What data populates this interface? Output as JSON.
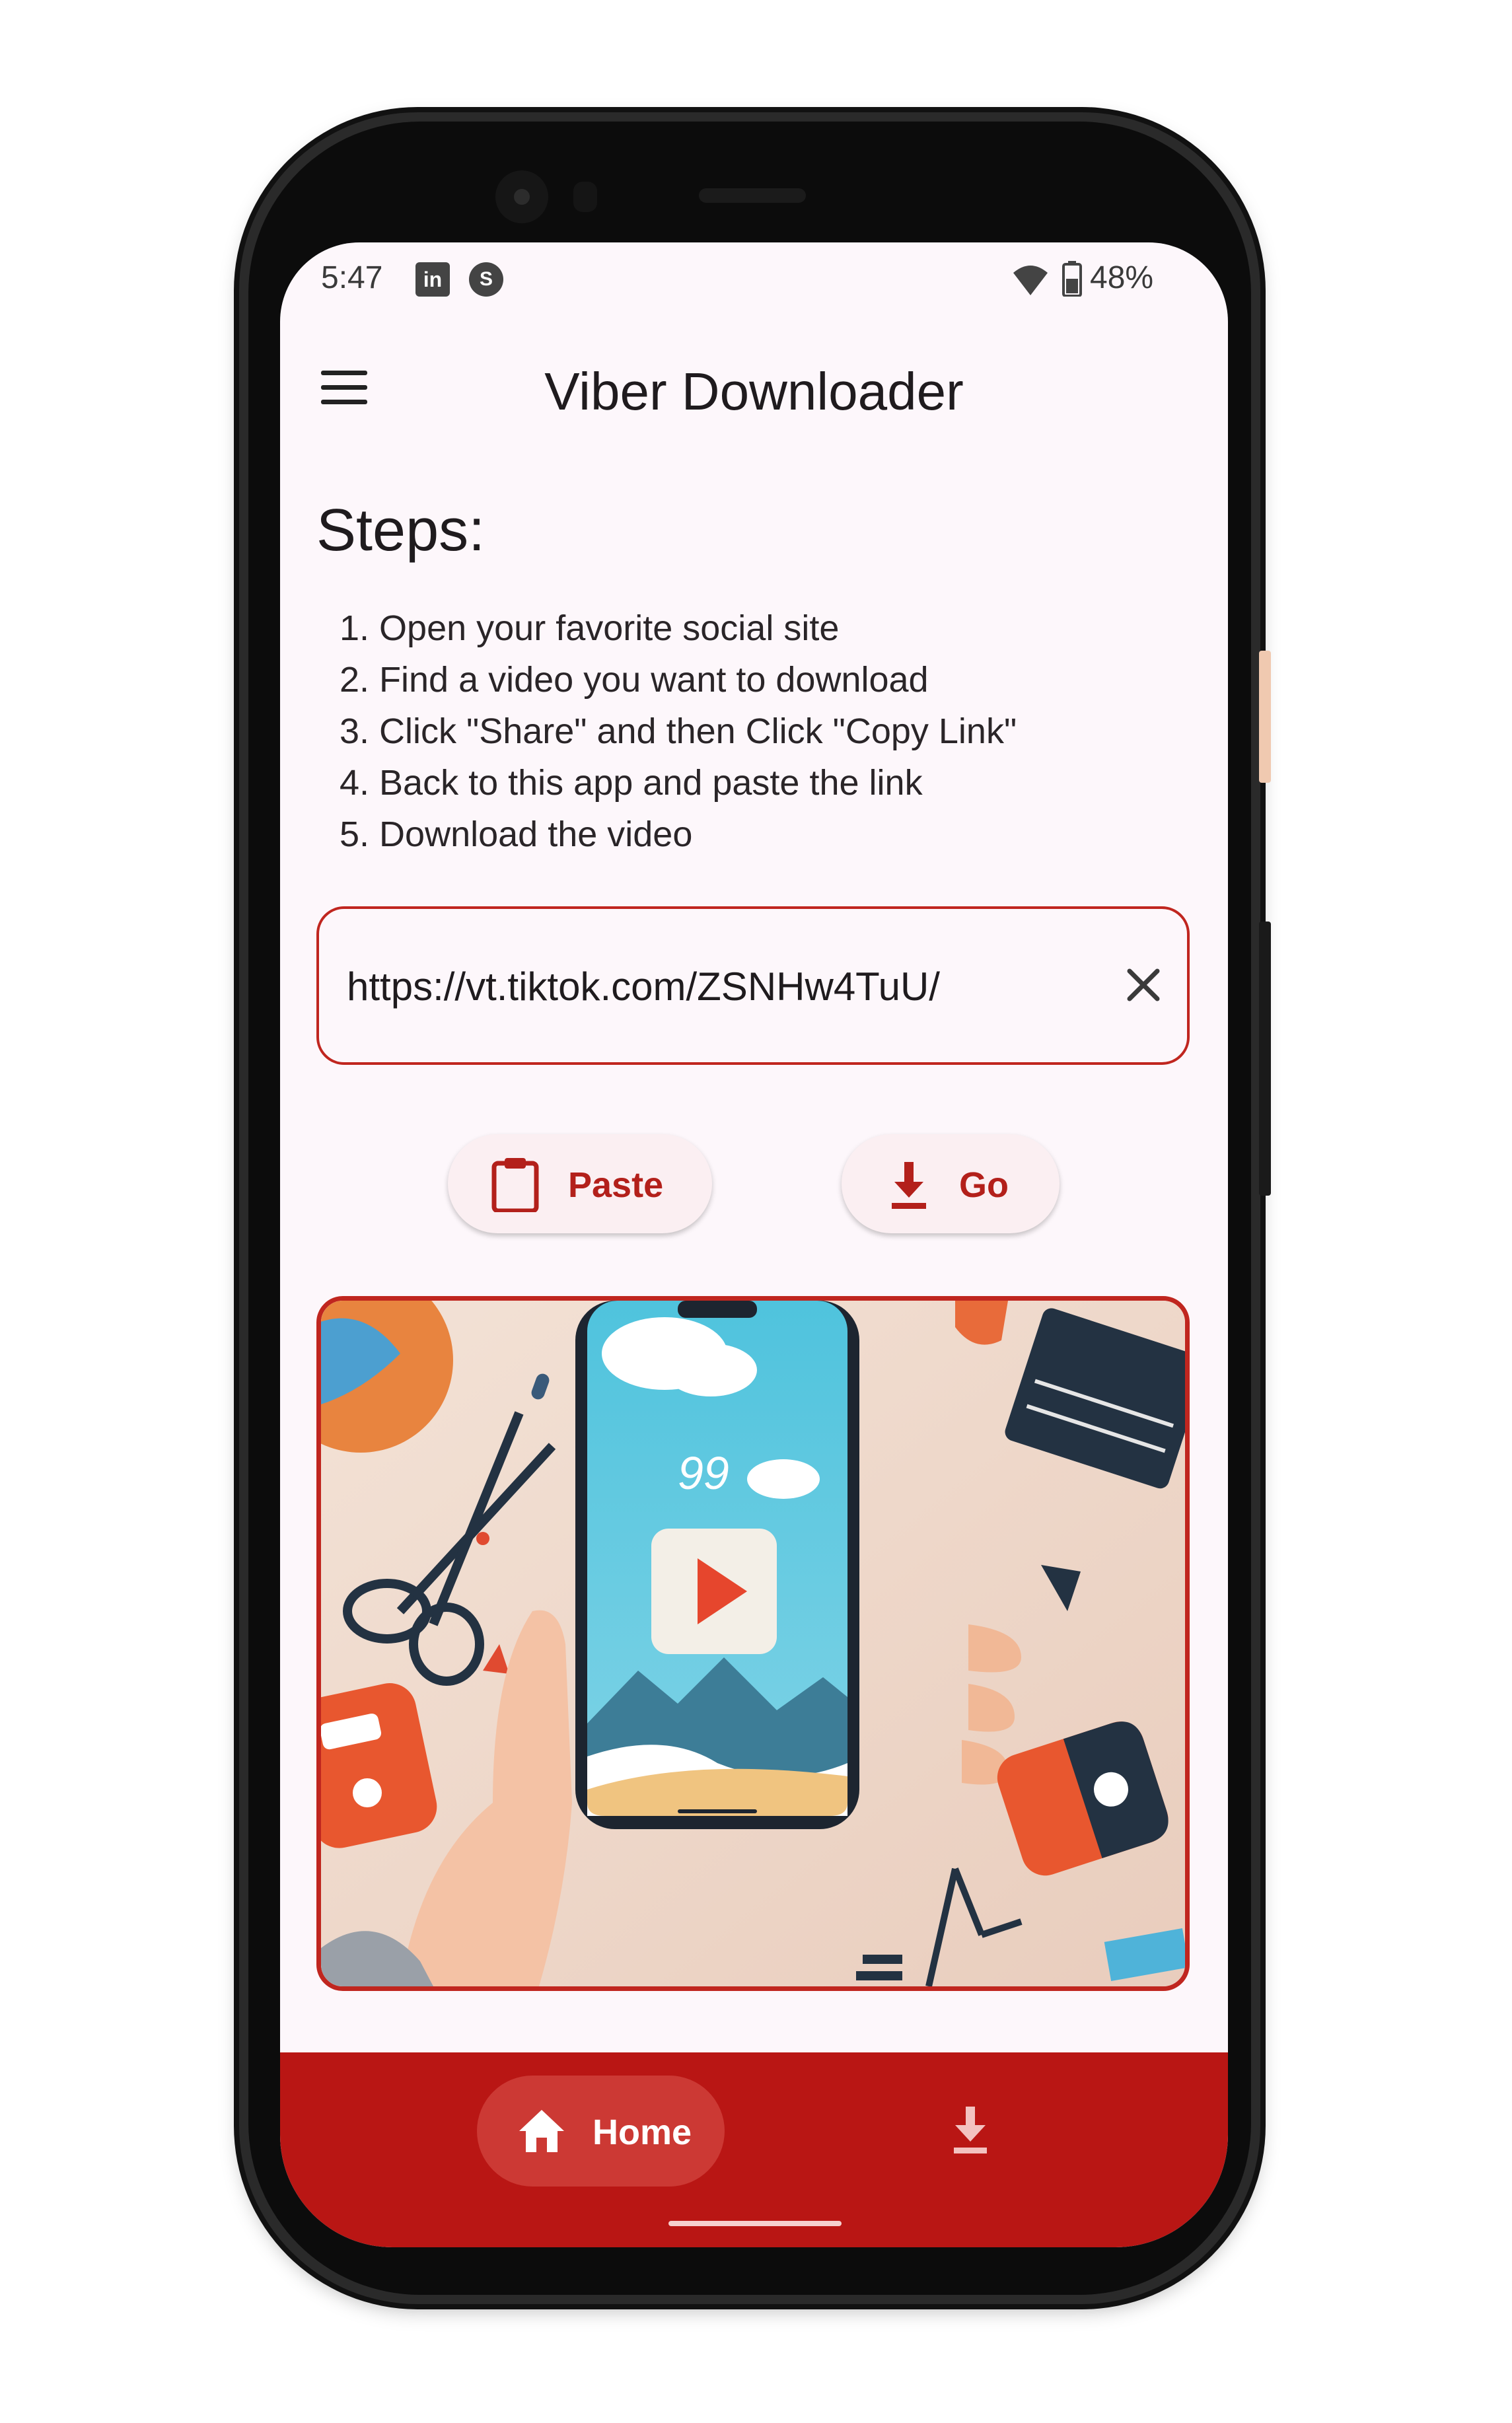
{
  "status_bar": {
    "time": "5:47",
    "notification_icons": [
      "linkedin-icon",
      "shazam-icon"
    ],
    "battery_percent": "48%",
    "wifi_icon": "wifi-icon",
    "battery_icon": "battery-icon"
  },
  "app_bar": {
    "title": "Viber Downloader",
    "menu_icon": "hamburger-menu-icon"
  },
  "steps": {
    "title": "Steps:",
    "items": [
      "1. Open your favorite social site",
      "2. Find a video you want to download",
      "3. Click \"Share\" and then Click \"Copy Link\"",
      "4. Back to this app and paste the link",
      "5. Download the video"
    ]
  },
  "url_input": {
    "value": "https://vt.tiktok.com/ZSNHw4TuU/",
    "clear_icon": "close-icon"
  },
  "buttons": {
    "paste_label": "Paste",
    "paste_icon": "clipboard-icon",
    "go_label": "Go",
    "go_icon": "download-icon"
  },
  "hero_image": {
    "screen_number": "99",
    "play_icon": "play-icon"
  },
  "bottom_nav": {
    "home_label": "Home",
    "home_icon": "home-icon",
    "downloads_icon": "download-icon",
    "active": "Home"
  },
  "colors": {
    "accent": "#c0261f",
    "nav_background": "#b91614",
    "nav_active_pill": "#cc3934",
    "screen_background": "#fdf7fb",
    "button_background": "#fbeff2"
  }
}
